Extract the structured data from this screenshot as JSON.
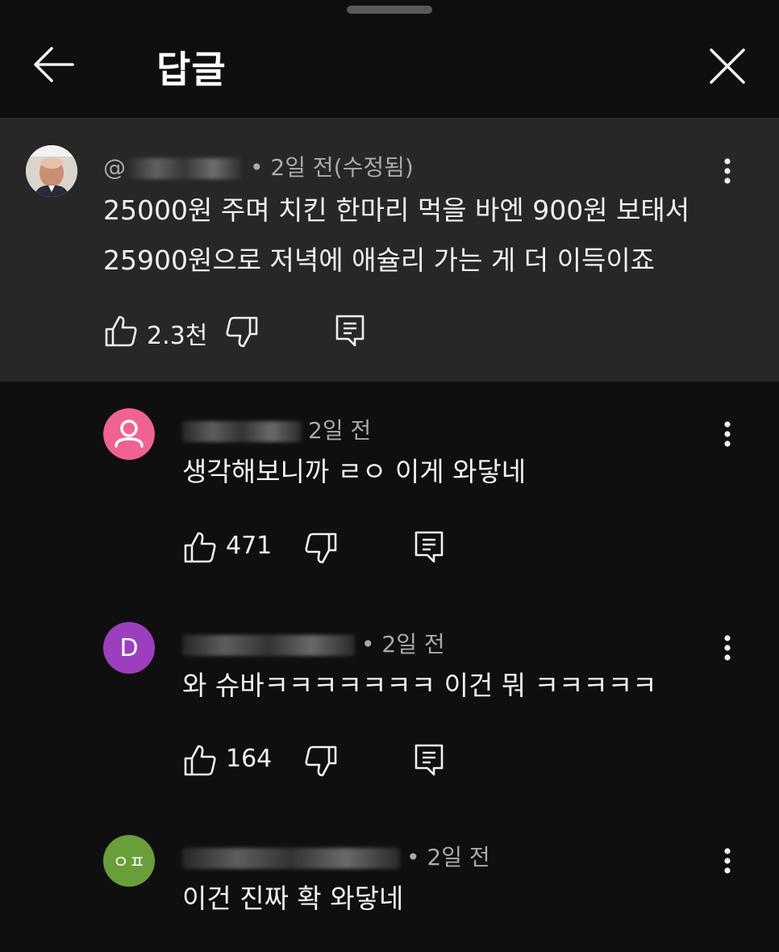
{
  "header": {
    "title": "답글"
  },
  "top_comment": {
    "author_prefix": "@",
    "meta": "• 2일 전(수정됨)",
    "lines": [
      "25000원 주며 치킨 한마리 먹을 바엔 900원 보태서",
      "25900원으로 저녁에 애슐리 가는 게 더 이득이죠"
    ],
    "likes": "2.3천"
  },
  "replies": [
    {
      "avatar_letter": "",
      "avatar_color": "#f06292",
      "meta": "2일 전",
      "text": "생각해보니까 ㄹㅇ 이게 와닿네",
      "likes": "471"
    },
    {
      "avatar_letter": "D",
      "avatar_color": "#9c3fbf",
      "meta": "• 2일 전",
      "text": "와 슈바ㅋㅋㅋㅋㅋㅋㅋ 이건 뭐 ㅋㅋㅋㅋㅋ",
      "likes": "164"
    },
    {
      "avatar_letter": "ㅇㅍ",
      "avatar_color": "#689f38",
      "meta": "• 2일 전",
      "text": "이건 진짜 확 와닿네"
    }
  ],
  "icons": {
    "back": "arrow-left-icon",
    "close": "close-icon",
    "more": "more-vert-icon",
    "like": "thumb-up-icon",
    "dislike": "thumb-down-icon",
    "reply": "reply-icon"
  }
}
